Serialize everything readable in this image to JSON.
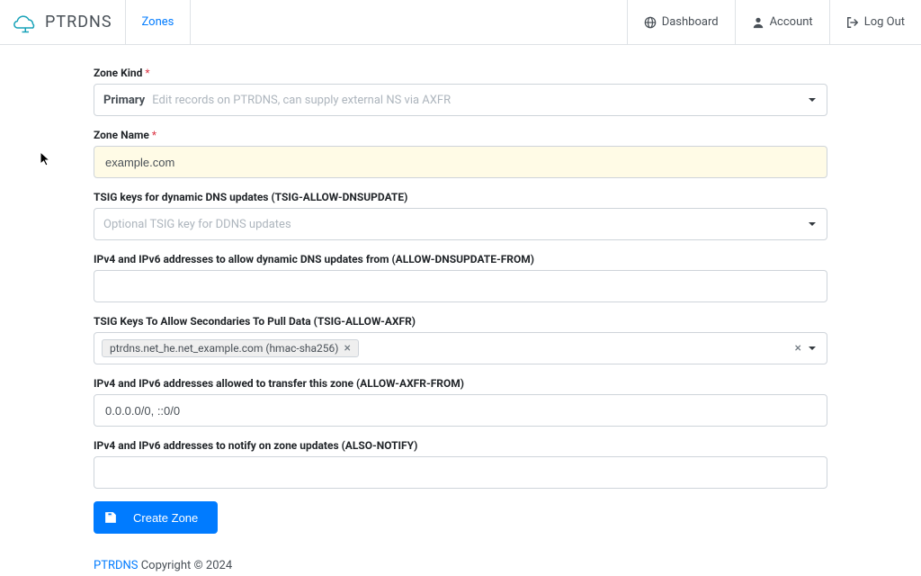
{
  "nav": {
    "brand": "PTRDNS",
    "zones": "Zones",
    "dashboard": "Dashboard",
    "account": "Account",
    "logout": "Log Out"
  },
  "form": {
    "zone_kind": {
      "label": "Zone Kind",
      "value": "Primary",
      "hint": "Edit records on PTRDNS, can supply external NS via AXFR"
    },
    "zone_name": {
      "label": "Zone Name",
      "value": "example.com"
    },
    "tsig_update": {
      "label": "TSIG keys for dynamic DNS updates (TSIG-ALLOW-DNSUPDATE)",
      "placeholder": "Optional TSIG key for DDNS updates"
    },
    "allow_dnsupdate_from": {
      "label": "IPv4 and IPv6 addresses to allow dynamic DNS updates from (ALLOW-DNSUPDATE-FROM)",
      "value": ""
    },
    "tsig_axfr": {
      "label": "TSIG Keys To Allow Secondaries To Pull Data (TSIG-ALLOW-AXFR)",
      "tag": "ptrdns.net_he.net_example.com (hmac-sha256)"
    },
    "allow_axfr_from": {
      "label": "IPv4 and IPv6 addresses allowed to transfer this zone (ALLOW-AXFR-FROM)",
      "value": "0.0.0.0/0, ::0/0"
    },
    "also_notify": {
      "label": "IPv4 and IPv6 addresses to notify on zone updates (ALSO-NOTIFY)",
      "value": ""
    },
    "submit": "Create Zone"
  },
  "footer": {
    "brand": "PTRDNS",
    "copyright": " Copyright © 2024"
  }
}
